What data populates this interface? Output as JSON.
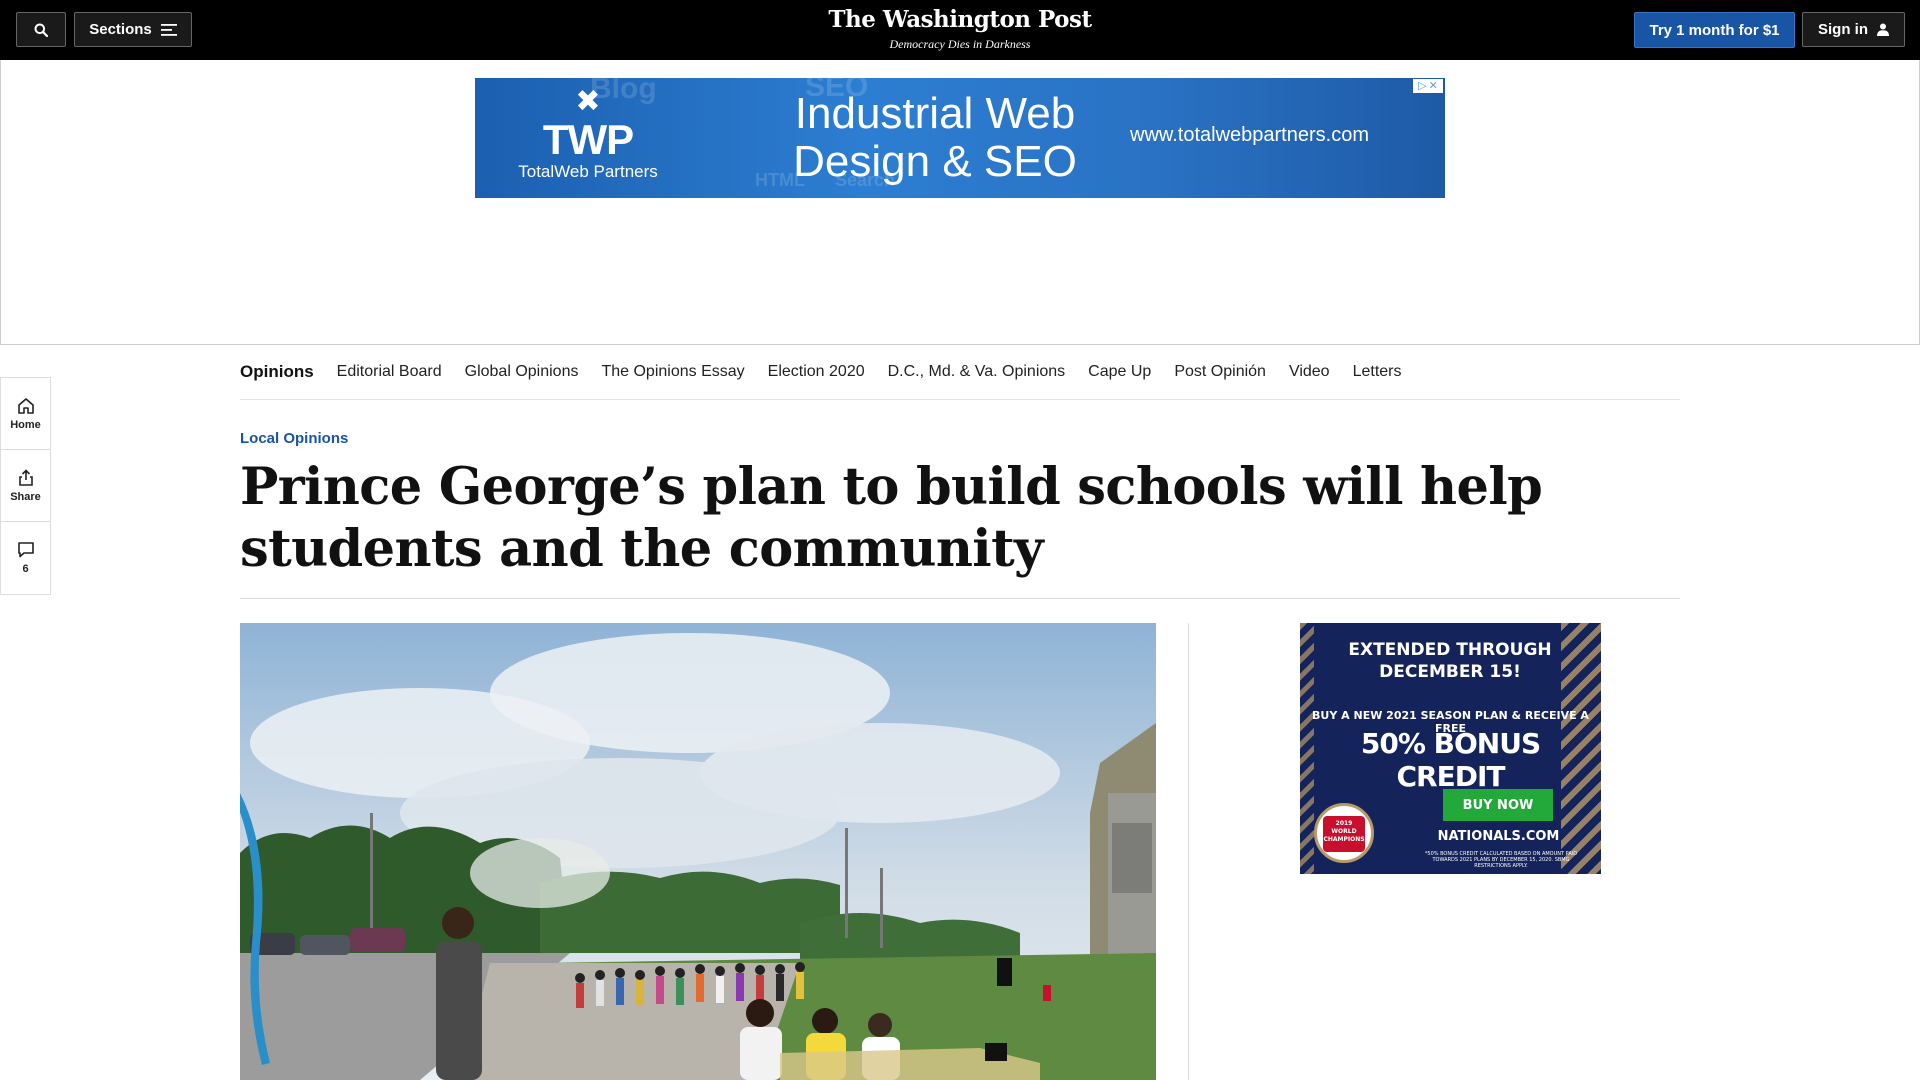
{
  "header": {
    "sections_label": "Sections",
    "logo": "The Washington Post",
    "tagline": "Democracy Dies in Darkness",
    "subscribe_label": "Try 1 month for $1",
    "signin_label": "Sign in"
  },
  "top_ad": {
    "brand_letters": "TWP",
    "brand_name": "TotalWeb Partners",
    "headline": "Industrial Web Design & SEO",
    "url": "www.totalwebpartners.com",
    "background_words": [
      "Blog",
      "SEO",
      "HTML",
      "Search"
    ]
  },
  "section_nav": {
    "active": "Opinions",
    "items": [
      "Editorial Board",
      "Global Opinions",
      "The Opinions Essay",
      "Election 2020",
      "D.C., Md. & Va. Opinions",
      "Cape Up",
      "Post Opinión",
      "Video",
      "Letters"
    ]
  },
  "left_rail": {
    "home_label": "Home",
    "share_label": "Share",
    "comment_count": "6"
  },
  "article": {
    "kicker": "Local Opinions",
    "headline": "Prince George’s plan to build schools will help students and the community"
  },
  "side_ad": {
    "line1": "EXTENDED THROUGH DECEMBER 15!",
    "line2": "BUY A NEW 2021 SEASON PLAN & RECEIVE A FREE",
    "line3": "50% BONUS CREDIT",
    "badge_text": "2019 WORLD CHAMPIONS",
    "button": "BUY NOW",
    "url": "NATIONALS.COM",
    "fine_print": "*50% BONUS CREDIT CALCULATED BASED ON AMOUNT PAID TOWARDS 2021 PLANS BY DECEMBER 15, 2020. SBMG RESTRICTIONS APPLY."
  },
  "colors": {
    "topbar": "#000000",
    "accent_blue": "#1955a5",
    "nats_navy": "#14245a",
    "nats_gold": "#b89968",
    "buy_green": "#23a83a"
  }
}
